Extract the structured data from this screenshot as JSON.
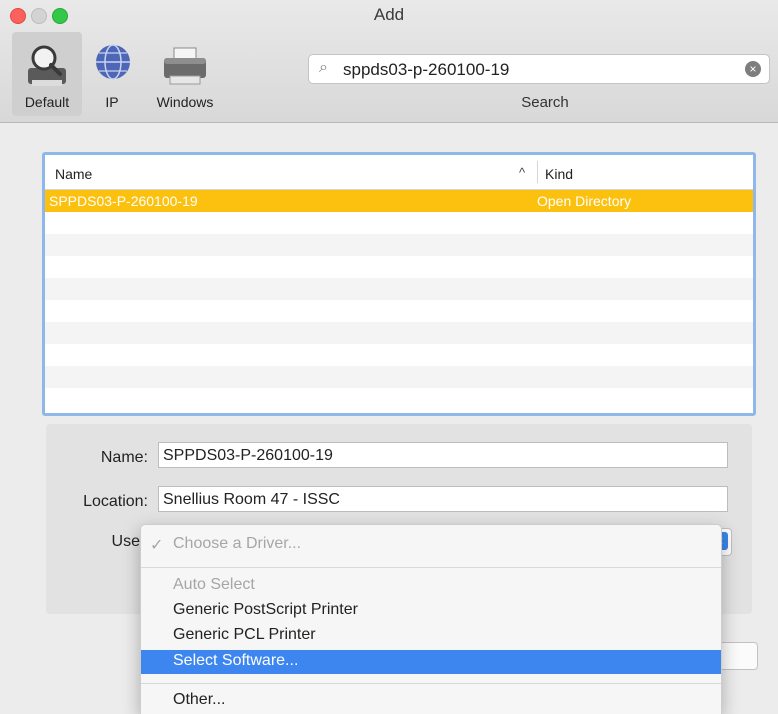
{
  "window": {
    "title": "Add"
  },
  "toolbar": {
    "default_label": "Default",
    "ip_label": "IP",
    "windows_label": "Windows",
    "search_value": "sppds03-p-260100-19",
    "search_label": "Search"
  },
  "table": {
    "col_name": "Name",
    "col_kind": "Kind",
    "sort_indicator": "^",
    "rows": [
      {
        "name": "SPPDS03-P-260100-19",
        "kind": "Open Directory",
        "selected": true
      }
    ]
  },
  "form": {
    "name_label": "Name:",
    "name_value": "SPPDS03-P-260100-19",
    "location_label": "Location:",
    "location_value": "Snellius Room 47 - ISSC",
    "use_label": "Use"
  },
  "menu": {
    "items": [
      {
        "label": "Choose a Driver...",
        "check": "✓",
        "state": "disabled"
      },
      {
        "label": "Auto Select",
        "state": "disabled"
      },
      {
        "label": "Generic PostScript Printer",
        "state": "normal"
      },
      {
        "label": "Generic PCL Printer",
        "state": "normal"
      },
      {
        "label": "Select Software...",
        "state": "highlighted"
      },
      {
        "label": "Other...",
        "state": "normal"
      }
    ]
  },
  "colors": {
    "selection": "#fcc10e",
    "menu_highlight": "#3d86f0",
    "table_focus": "#8fb7ea"
  }
}
